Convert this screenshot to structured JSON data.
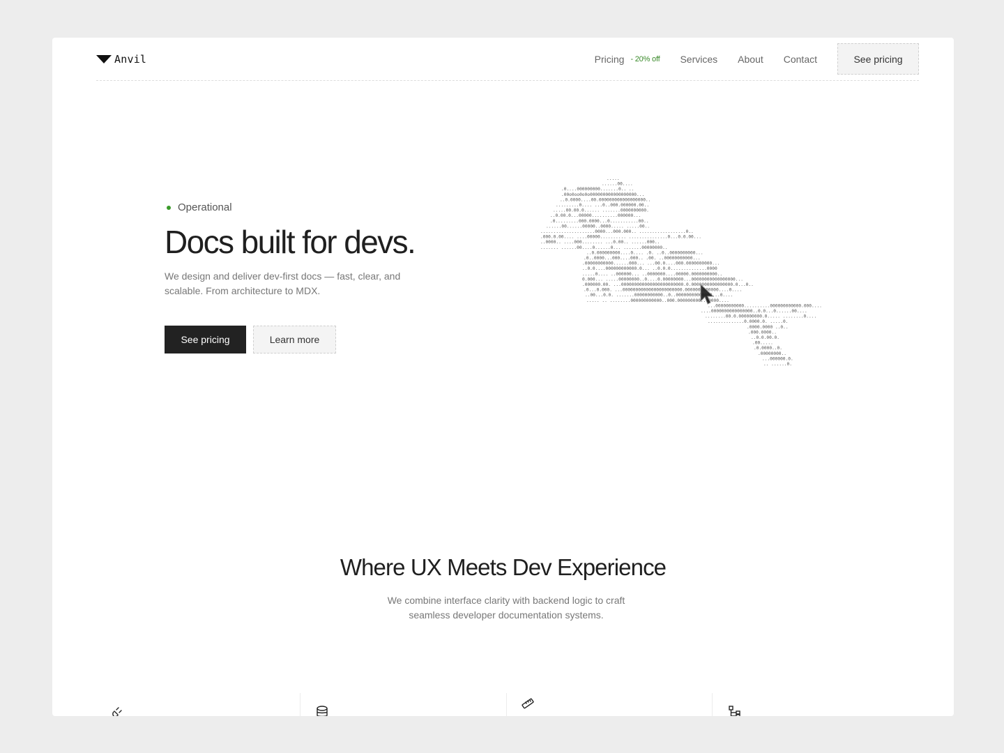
{
  "brand": {
    "name": "Anvil",
    "logo_icon": "triangle-down-logo"
  },
  "nav": {
    "pricing_label": "Pricing",
    "pricing_badge": "- 20% off",
    "services_label": "Services",
    "about_label": "About",
    "contact_label": "Contact",
    "cta_label": "See pricing"
  },
  "hero": {
    "status": "Operational",
    "status_color": "#3a9a2a",
    "title": "Docs built for devs.",
    "subtitle": "We design and deliver dev-first docs — fast, clear, and scalable. From architecture to MDX.",
    "primary_button": "See pricing",
    "secondary_button": "Learn more",
    "illustration": "ascii-world-map"
  },
  "section": {
    "title": "Where UX Meets Dev Experience",
    "subtitle": "We combine interface clarity with backend logic to craft seamless developer documentation systems."
  },
  "features": [
    {
      "icon": "plug-icon"
    },
    {
      "icon": "database-icon"
    },
    {
      "icon": "ruler-icon"
    },
    {
      "icon": "hierarchy-icon"
    }
  ],
  "colors": {
    "background": "#ededed",
    "surface": "#ffffff",
    "primary_button": "#222222",
    "badge_green": "#3a8a2a"
  }
}
